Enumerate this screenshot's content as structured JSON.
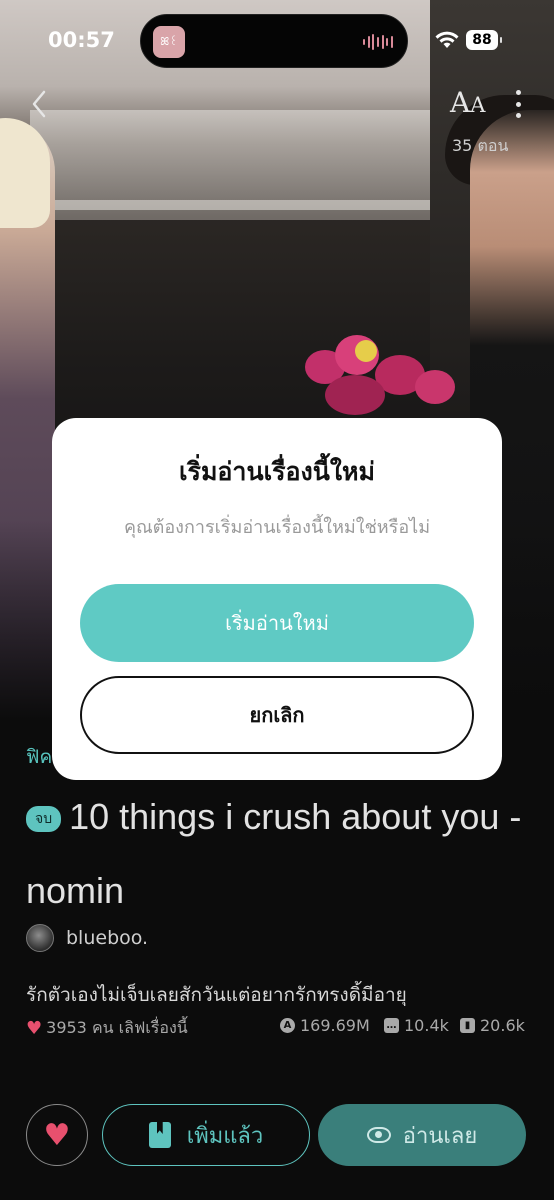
{
  "status_bar": {
    "time": "00:57",
    "battery": "88",
    "island_app_label": "ꕤ꒰"
  },
  "header": {
    "font_button": "A",
    "font_button_small": "A",
    "episode_count": "35 ตอน"
  },
  "story": {
    "genre": "ฟิค",
    "tag": "จบ",
    "title": "10 things i crush about you - nomin",
    "author": "blueboo.",
    "description": "รักตัวเองไม่เจ็บเลยสักวันแต่อยากรักทรงดิ้มีอายุ",
    "likes_text": "3953 คน เลิฟเรื่องนี้",
    "views": "169.69M",
    "comments": "10.4k",
    "bookmarks": "20.6k"
  },
  "actions": {
    "added_label": "เพิ่มแล้ว",
    "read_label": "อ่านเลย"
  },
  "modal": {
    "title": "เริ่มอ่านเรื่องนี้ใหม่",
    "message": "คุณต้องการเริ่มอ่านเรื่องนี้ใหม่ใช่หรือไม่",
    "confirm_label": "เริ่มอ่านใหม่",
    "cancel_label": "ยกเลิก"
  },
  "colors": {
    "accent": "#5fcac4",
    "accent_dark": "#3a7f7b",
    "heart": "#e8506e"
  }
}
